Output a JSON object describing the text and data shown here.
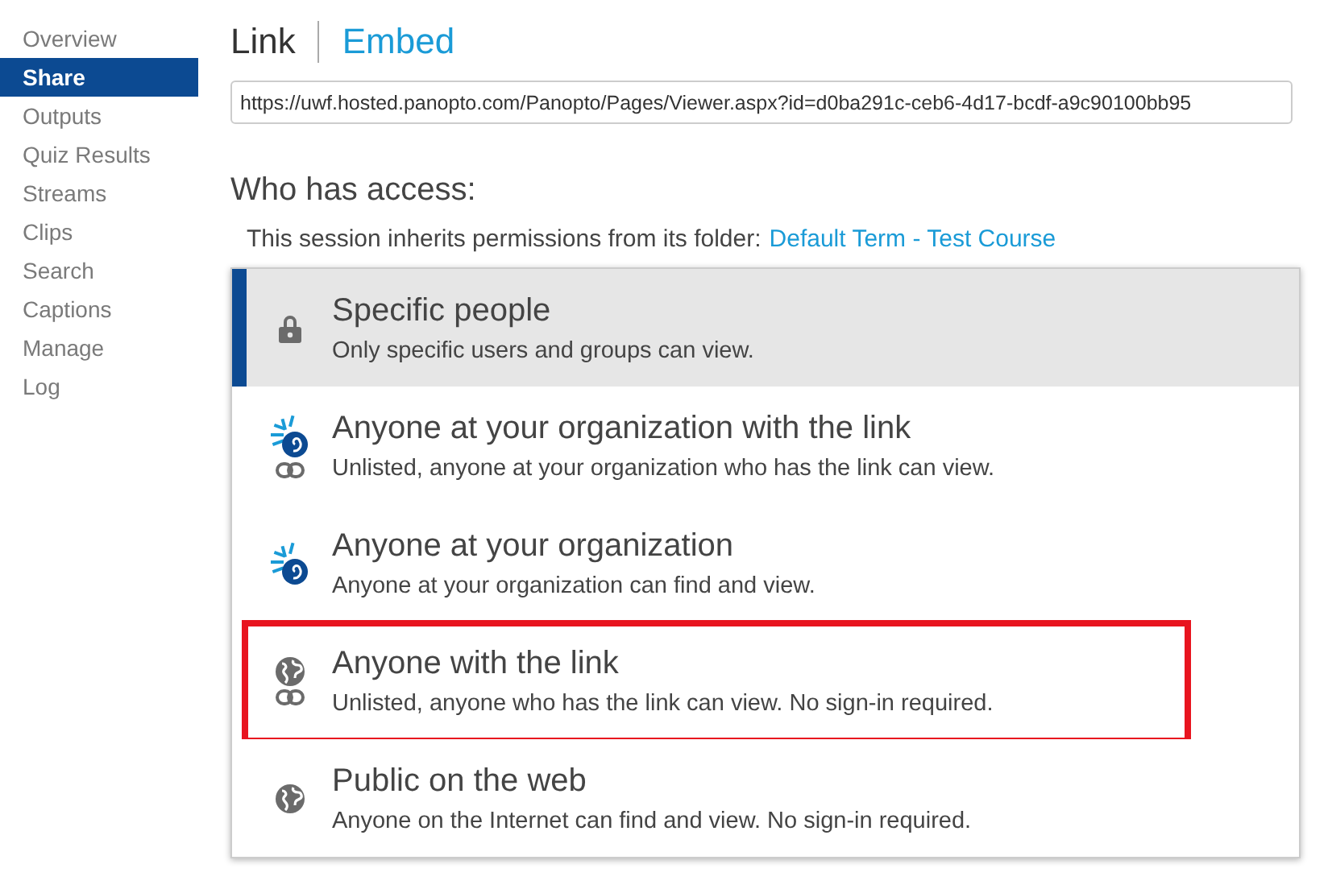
{
  "sidebar": {
    "items": [
      {
        "label": "Overview",
        "selected": false
      },
      {
        "label": "Share",
        "selected": true
      },
      {
        "label": "Outputs",
        "selected": false
      },
      {
        "label": "Quiz Results",
        "selected": false
      },
      {
        "label": "Streams",
        "selected": false
      },
      {
        "label": "Clips",
        "selected": false
      },
      {
        "label": "Search",
        "selected": false
      },
      {
        "label": "Captions",
        "selected": false
      },
      {
        "label": "Manage",
        "selected": false
      },
      {
        "label": "Log",
        "selected": false
      }
    ]
  },
  "tabs": [
    {
      "label": "Link",
      "selected": true
    },
    {
      "label": "Embed",
      "selected": false
    }
  ],
  "url_field": {
    "value": "https://uwf.hosted.panopto.com/Panopto/Pages/Viewer.aspx?id=d0ba291c-ceb6-4d17-bcdf-a9c90100bb95"
  },
  "access": {
    "heading": "Who has access:",
    "inherit_text": "This session inherits permissions from its folder:",
    "folder_link": "Default Term - Test Course",
    "options": [
      {
        "kind": "lock",
        "link": false,
        "title": "Specific people",
        "description": "Only specific users and groups can view.",
        "selected": true,
        "highlighted": false
      },
      {
        "kind": "org",
        "link": true,
        "title": "Anyone at your organization with the link",
        "description": "Unlisted, anyone at your organization who has the link can view.",
        "selected": false,
        "highlighted": false
      },
      {
        "kind": "org",
        "link": false,
        "title": "Anyone at your organization",
        "description": "Anyone at your organization can find and view.",
        "selected": false,
        "highlighted": false
      },
      {
        "kind": "globe",
        "link": true,
        "title": "Anyone with the link",
        "description": "Unlisted, anyone who has the link can view. No sign-in required.",
        "selected": false,
        "highlighted": true
      },
      {
        "kind": "globe",
        "link": false,
        "title": "Public on the web",
        "description": "Anyone on the Internet can find and view. No sign-in required.",
        "selected": false,
        "highlighted": false
      }
    ]
  }
}
